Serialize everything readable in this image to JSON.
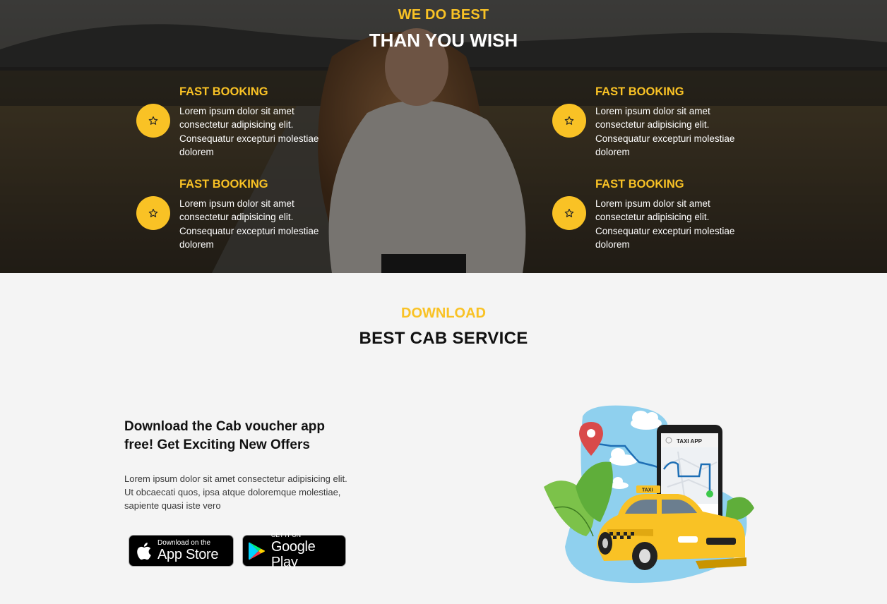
{
  "hero": {
    "kicker": "WE DO BEST",
    "title": "THAN YOU WISH",
    "features": [
      {
        "title": "FAST BOOKING",
        "text": "Lorem ipsum dolor sit amet consectetur adipisicing elit. Consequatur excepturi molestiae dolorem",
        "icon": "star-icon"
      },
      {
        "title": "FAST BOOKING",
        "text": "Lorem ipsum dolor sit amet consectetur adipisicing elit. Consequatur excepturi molestiae dolorem",
        "icon": "star-icon"
      },
      {
        "title": "FAST BOOKING",
        "text": "Lorem ipsum dolor sit amet consectetur adipisicing elit. Consequatur excepturi molestiae dolorem",
        "icon": "star-icon"
      },
      {
        "title": "FAST BOOKING",
        "text": "Lorem ipsum dolor sit amet consectetur adipisicing elit. Consequatur excepturi molestiae dolorem",
        "icon": "star-icon"
      }
    ]
  },
  "download": {
    "kicker": "DOWNLOAD",
    "title": "BEST CAB SERVICE",
    "heading": "Download the Cab voucher app free! Get Exciting New Offers",
    "text": "Lorem ipsum dolor sit amet consectetur adipisicing elit. Ut obcaecati quos, ipsa atque doloremque molestiae, sapiente quasi iste vero",
    "app_store": {
      "small": "Download on the",
      "big": "App Store",
      "icon": "apple-icon"
    },
    "google_play": {
      "small": "GET IT ON",
      "big": "Google Play",
      "icon": "google-play-icon"
    },
    "illustration": {
      "phone_label": "TAXI APP",
      "taxi_sign": "TAXI"
    }
  },
  "colors": {
    "accent": "#f9c225",
    "dark_text": "#111111",
    "page_bg": "#f4f4f4"
  }
}
